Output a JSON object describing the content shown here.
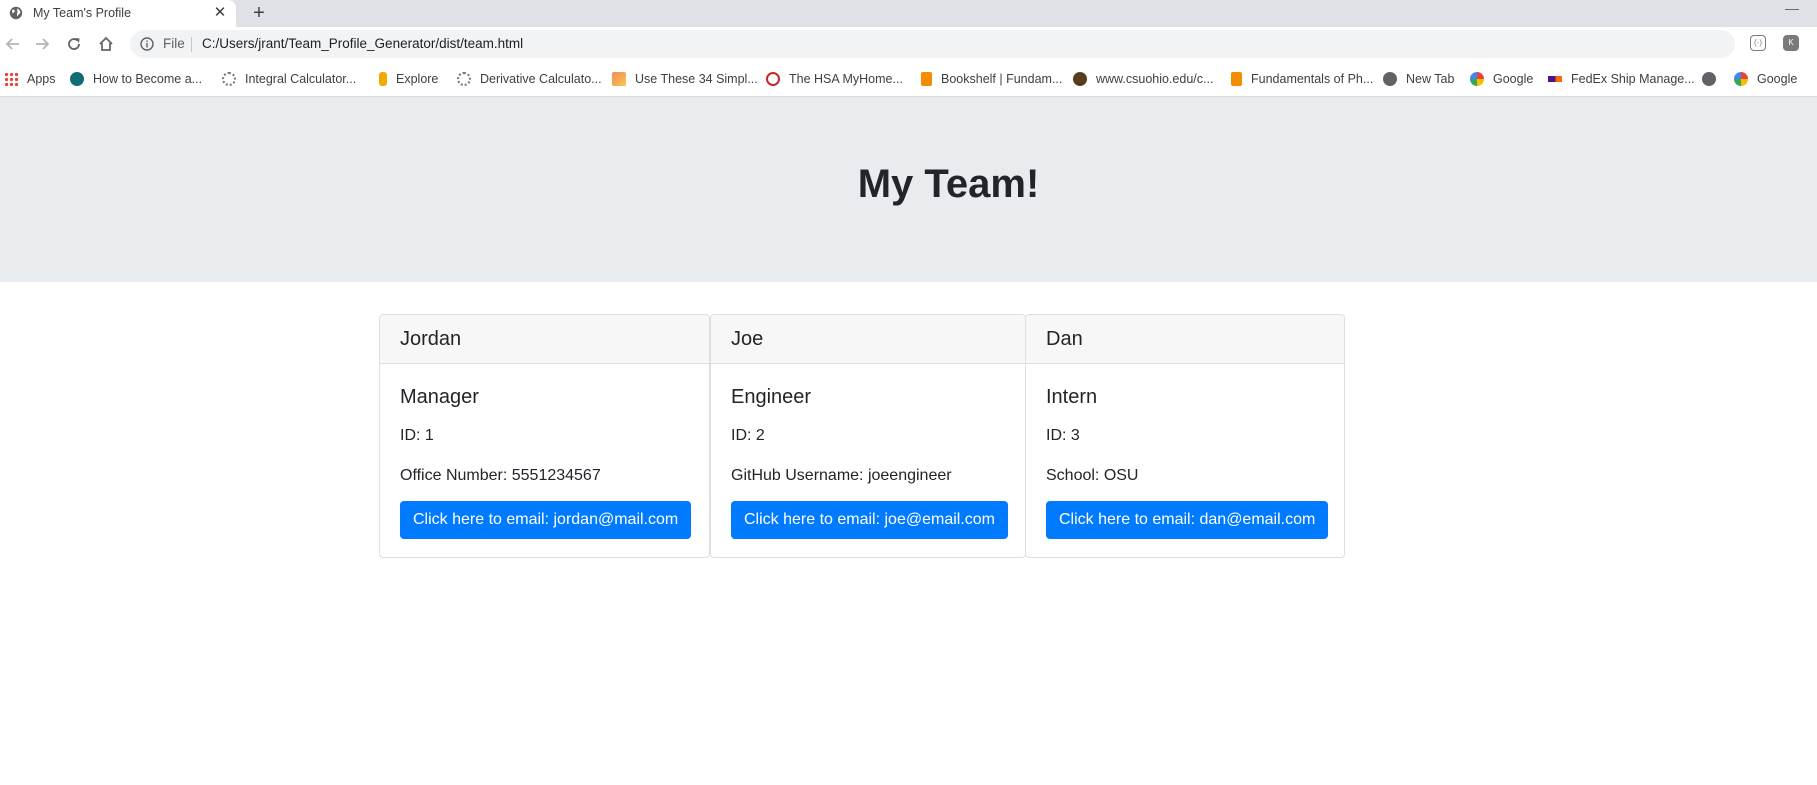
{
  "browser": {
    "tab_title": "My Team's Profile",
    "tab_close": "✕",
    "new_tab": "+",
    "minimize": "—",
    "scheme": "File",
    "url": "C:/Users/jrant/Team_Profile_Generator/dist/team.html"
  },
  "bookmarks": [
    {
      "label": "Apps",
      "icon": "apps-grid-icon"
    },
    {
      "label": "How to Become a...",
      "icon": "globe-teal-icon"
    },
    {
      "label": "Integral Calculator...",
      "icon": "gear-icon"
    },
    {
      "label": "Explore",
      "icon": "explore-icon"
    },
    {
      "label": "Derivative Calculato...",
      "icon": "gear-icon"
    },
    {
      "label": "Use These 34 Simpl...",
      "icon": "feather-icon"
    },
    {
      "label": "The HSA MyHome...",
      "icon": "hsa-icon"
    },
    {
      "label": "Bookshelf | Fundam...",
      "icon": "bookshelf-icon"
    },
    {
      "label": "www.csuohio.edu/c...",
      "icon": "csu-icon"
    },
    {
      "label": "Fundamentals of Ph...",
      "icon": "bookshelf-icon"
    },
    {
      "label": "New Tab",
      "icon": "globe-icon"
    },
    {
      "label": "Google",
      "icon": "google-icon"
    },
    {
      "label": "FedEx Ship Manage...",
      "icon": "fedex-icon"
    },
    {
      "label": "",
      "icon": "globe-icon"
    },
    {
      "label": "Google",
      "icon": "google-icon"
    }
  ],
  "page": {
    "title": "My Team!"
  },
  "team": [
    {
      "name": "Jordan",
      "role": "Manager",
      "id_text": "ID: 1",
      "detail": "Office Number: 5551234567",
      "email_button": "Click here to email: jordan@mail.com"
    },
    {
      "name": "Joe",
      "role": "Engineer",
      "id_text": "ID: 2",
      "detail": "GitHub Username: joeengineer",
      "email_button": "Click here to email: joe@email.com"
    },
    {
      "name": "Dan",
      "role": "Intern",
      "id_text": "ID: 3",
      "detail": "School: OSU",
      "email_button": "Click here to email: dan@email.com"
    }
  ],
  "colors": {
    "jumbotron": "#e9ecef",
    "button": "#007bff",
    "card_header": "#f7f7f7"
  }
}
